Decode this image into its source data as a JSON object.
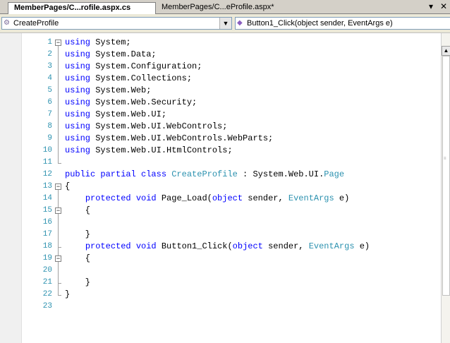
{
  "tabs": [
    {
      "label": "MemberPages/C...rofile.aspx.cs",
      "active": true
    },
    {
      "label": "MemberPages/C...eProfile.aspx*",
      "active": false
    }
  ],
  "tab_controls": {
    "dropdown_icon": "▾",
    "close_icon": "✕"
  },
  "nav": {
    "class_combo": "CreateProfile",
    "member_combo": "Button1_Click(object sender, EventArgs e)"
  },
  "code_lines": [
    {
      "n": "1",
      "segments": [
        {
          "t": "using",
          "c": "kw"
        },
        {
          "t": " System;",
          "c": ""
        }
      ]
    },
    {
      "n": "2",
      "segments": [
        {
          "t": "using",
          "c": "kw"
        },
        {
          "t": " System.Data;",
          "c": ""
        }
      ]
    },
    {
      "n": "3",
      "segments": [
        {
          "t": "using",
          "c": "kw"
        },
        {
          "t": " System.Configuration;",
          "c": ""
        }
      ]
    },
    {
      "n": "4",
      "segments": [
        {
          "t": "using",
          "c": "kw"
        },
        {
          "t": " System.Collections;",
          "c": ""
        }
      ]
    },
    {
      "n": "5",
      "segments": [
        {
          "t": "using",
          "c": "kw"
        },
        {
          "t": " System.Web;",
          "c": ""
        }
      ]
    },
    {
      "n": "6",
      "segments": [
        {
          "t": "using",
          "c": "kw"
        },
        {
          "t": " System.Web.Security;",
          "c": ""
        }
      ]
    },
    {
      "n": "7",
      "segments": [
        {
          "t": "using",
          "c": "kw"
        },
        {
          "t": " System.Web.UI;",
          "c": ""
        }
      ]
    },
    {
      "n": "8",
      "segments": [
        {
          "t": "using",
          "c": "kw"
        },
        {
          "t": " System.Web.UI.WebControls;",
          "c": ""
        }
      ]
    },
    {
      "n": "9",
      "segments": [
        {
          "t": "using",
          "c": "kw"
        },
        {
          "t": " System.Web.UI.WebControls.WebParts;",
          "c": ""
        }
      ]
    },
    {
      "n": "10",
      "segments": [
        {
          "t": "using",
          "c": "kw"
        },
        {
          "t": " System.Web.UI.HtmlControls;",
          "c": ""
        }
      ]
    },
    {
      "n": "11",
      "segments": []
    },
    {
      "n": "12",
      "segments": [
        {
          "t": "public partial class",
          "c": "kw"
        },
        {
          "t": " ",
          "c": ""
        },
        {
          "t": "CreateProfile",
          "c": "ty"
        },
        {
          "t": " : System.Web.UI.",
          "c": ""
        },
        {
          "t": "Page",
          "c": "ty"
        }
      ]
    },
    {
      "n": "13",
      "segments": [
        {
          "t": "{",
          "c": ""
        }
      ]
    },
    {
      "n": "14",
      "segments": [
        {
          "t": "    ",
          "c": ""
        },
        {
          "t": "protected void",
          "c": "kw"
        },
        {
          "t": " Page_Load(",
          "c": ""
        },
        {
          "t": "object",
          "c": "kw"
        },
        {
          "t": " sender, ",
          "c": ""
        },
        {
          "t": "EventArgs",
          "c": "ty"
        },
        {
          "t": " e)",
          "c": ""
        }
      ]
    },
    {
      "n": "15",
      "segments": [
        {
          "t": "    {",
          "c": ""
        }
      ]
    },
    {
      "n": "16",
      "segments": []
    },
    {
      "n": "17",
      "segments": [
        {
          "t": "    }",
          "c": ""
        }
      ]
    },
    {
      "n": "18",
      "segments": [
        {
          "t": "    ",
          "c": ""
        },
        {
          "t": "protected void",
          "c": "kw"
        },
        {
          "t": " Button1_Click(",
          "c": ""
        },
        {
          "t": "object",
          "c": "kw"
        },
        {
          "t": " sender, ",
          "c": ""
        },
        {
          "t": "EventArgs",
          "c": "ty"
        },
        {
          "t": " e)",
          "c": ""
        }
      ]
    },
    {
      "n": "19",
      "segments": [
        {
          "t": "    {",
          "c": ""
        }
      ]
    },
    {
      "n": "20",
      "segments": []
    },
    {
      "n": "21",
      "segments": [
        {
          "t": "    }",
          "c": ""
        }
      ]
    },
    {
      "n": "22",
      "segments": [
        {
          "t": "}",
          "c": ""
        }
      ]
    },
    {
      "n": "23",
      "segments": []
    }
  ],
  "colors": {
    "keyword": "#0000ff",
    "type": "#2b91af",
    "line_number": "#2b91af"
  }
}
